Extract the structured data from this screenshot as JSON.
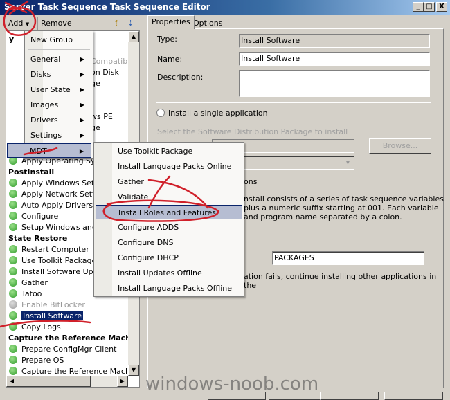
{
  "window": {
    "title": "Server Task Sequence Task Sequence Editor",
    "minimize": "_",
    "maximize": "□",
    "close": "X"
  },
  "toolbar": {
    "add": "Add",
    "remove": "Remove"
  },
  "tree": {
    "hidden_fragments": [
      "y",
      "Compatibi",
      "on Disk",
      "ge",
      "ws PE",
      "ge"
    ],
    "items": [
      {
        "label": "Apply Operating Syste",
        "type": "step"
      },
      {
        "label": "PostInstall",
        "type": "group"
      },
      {
        "label": "Apply Windows Settin",
        "type": "step"
      },
      {
        "label": "Apply Network Setting",
        "type": "step"
      },
      {
        "label": "Auto Apply Drivers",
        "type": "step"
      },
      {
        "label": "Configure",
        "type": "step"
      },
      {
        "label": "Setup Windows and C",
        "type": "step"
      },
      {
        "label": "State Restore",
        "type": "group"
      },
      {
        "label": "Restart Computer",
        "type": "step"
      },
      {
        "label": "Use Toolkit Package",
        "type": "step"
      },
      {
        "label": "Install Software Upda",
        "type": "step"
      },
      {
        "label": "Gather",
        "type": "step"
      },
      {
        "label": "Tatoo",
        "type": "step"
      },
      {
        "label": "Enable BitLocker",
        "type": "disabled"
      },
      {
        "label": "Install Software",
        "type": "selected"
      },
      {
        "label": "Copy Logs",
        "type": "step"
      },
      {
        "label": "Capture the Reference Machine",
        "type": "group"
      },
      {
        "label": "Prepare ConfigMgr Client",
        "type": "step"
      },
      {
        "label": "Prepare OS",
        "type": "step"
      },
      {
        "label": "Capture the Reference Machine",
        "type": "step"
      }
    ]
  },
  "add_menu": {
    "items": [
      "New Group",
      "General",
      "Disks",
      "User State",
      "Images",
      "Drivers",
      "Settings",
      "MDT"
    ],
    "highlighted": "MDT"
  },
  "mdt_submenu": {
    "items": [
      "Use Toolkit Package",
      "Install Language Packs Online",
      "Gather",
      "Validate",
      "Install Roles and Features",
      "Configure ADDS",
      "Configure DNS",
      "Configure DHCP",
      "Install Updates Offline",
      "Install Language Packs Offline"
    ],
    "highlighted": "Install Roles and Features"
  },
  "properties": {
    "tabs": [
      "Properties",
      "Options"
    ],
    "type_label": "Type:",
    "type_value": "Install Software",
    "name_label": "Name:",
    "name_value": "Install Software",
    "description_label": "Description:",
    "description_value": "",
    "radio_single": "Install a single application",
    "select_package": "Select the Software Distribution Package to install",
    "browse": "Browse...",
    "multiple_fragment": "ons",
    "para": [
      "nstall consists of a series of task sequence variables",
      "plus a numeric suffix starting at 001.  Each variable",
      "and program name separated by a colon."
    ],
    "base_variable_value": "PACKAGES",
    "continue_text": "ation fails, continue installing other applications in the"
  },
  "watermark": "windows-noob.com",
  "colors": {
    "annotation": "#d0202a",
    "highlight": "#b6bdd2",
    "selected": "#0a246a"
  }
}
